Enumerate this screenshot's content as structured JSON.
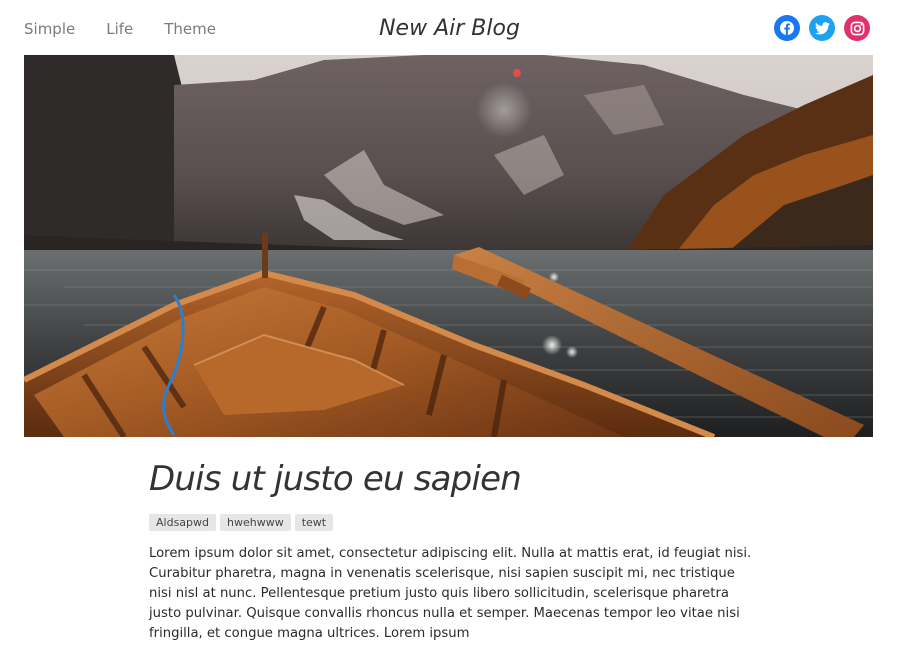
{
  "header": {
    "nav": [
      "Simple",
      "Life",
      "Theme"
    ],
    "brand": "New Air Blog",
    "social": [
      {
        "name": "facebook-icon",
        "color": "#1877f2"
      },
      {
        "name": "twitter-icon",
        "color": "#1da1f2"
      },
      {
        "name": "instagram-icon",
        "color": "#e1306c"
      }
    ]
  },
  "post": {
    "title": "Duis ut justo eu sapien",
    "tags": [
      "Aldsapwd",
      "hwehwww",
      "tewt"
    ],
    "excerpt": "Lorem ipsum dolor sit amet, consectetur adipiscing elit. Nulla at mattis erat, id feugiat nisi. Curabitur pharetra, magna in venenatis scelerisque, nisi sapien suscipit mi, nec tristique nisi nisl at nunc. Pellentesque pretium justo quis libero sollicitudin, scelerisque pharetra justo pulvinar. Quisque convallis rhoncus nulla et semper. Maecenas tempor leo vitae nisi fringilla, et congue magna ultrices. Lorem ipsum"
  }
}
